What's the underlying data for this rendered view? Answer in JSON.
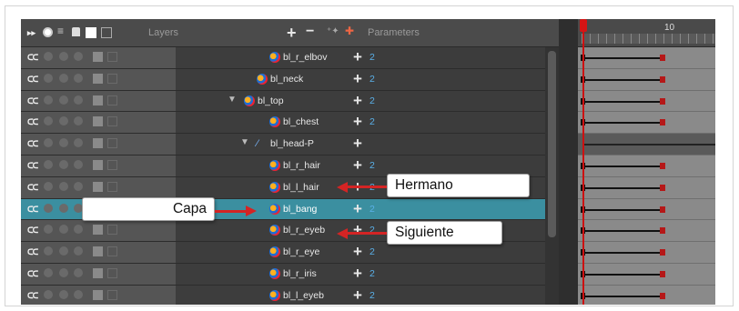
{
  "header": {
    "layers_label": "Layers",
    "parameters_label": "Parameters",
    "frame_number": "10"
  },
  "layers": [
    {
      "name": "bl_r_elbov",
      "param": "2",
      "indent": 2,
      "icon": "drawing",
      "expand": false
    },
    {
      "name": "bl_neck",
      "param": "2",
      "indent": 1,
      "icon": "drawing",
      "expand": false
    },
    {
      "name": "bl_top",
      "param": "2",
      "indent": 0,
      "icon": "drawing",
      "expand": true
    },
    {
      "name": "bl_chest",
      "param": "2",
      "indent": 2,
      "icon": "drawing",
      "expand": false
    },
    {
      "name": "bl_head-P",
      "param": "",
      "indent": 1,
      "icon": "peg",
      "expand": true
    },
    {
      "name": "bl_r_hair",
      "param": "2",
      "indent": 2,
      "icon": "drawing",
      "expand": false
    },
    {
      "name": "bl_l_hair",
      "param": "2",
      "indent": 2,
      "icon": "drawing",
      "expand": false
    },
    {
      "name": "bl_bang",
      "param": "2",
      "indent": 2,
      "icon": "drawing",
      "expand": false,
      "selected": true
    },
    {
      "name": "bl_r_eyeb",
      "param": "2",
      "indent": 2,
      "icon": "drawing",
      "expand": false
    },
    {
      "name": "bl_r_eye",
      "param": "2",
      "indent": 2,
      "icon": "drawing",
      "expand": false
    },
    {
      "name": "bl_r_iris",
      "param": "2",
      "indent": 2,
      "icon": "drawing",
      "expand": false
    },
    {
      "name": "bl_l_eyeb",
      "param": "2",
      "indent": 2,
      "icon": "drawing",
      "expand": false
    }
  ],
  "callouts": {
    "sibling": "Hermano",
    "layer": "Capa",
    "next": "Siguiente"
  },
  "colors": {
    "selected_row": "#3b8fa0",
    "param_value": "#5ab0e8",
    "keyframe": "#b51818",
    "playhead": "#cc1111",
    "arrow": "#d42424"
  }
}
